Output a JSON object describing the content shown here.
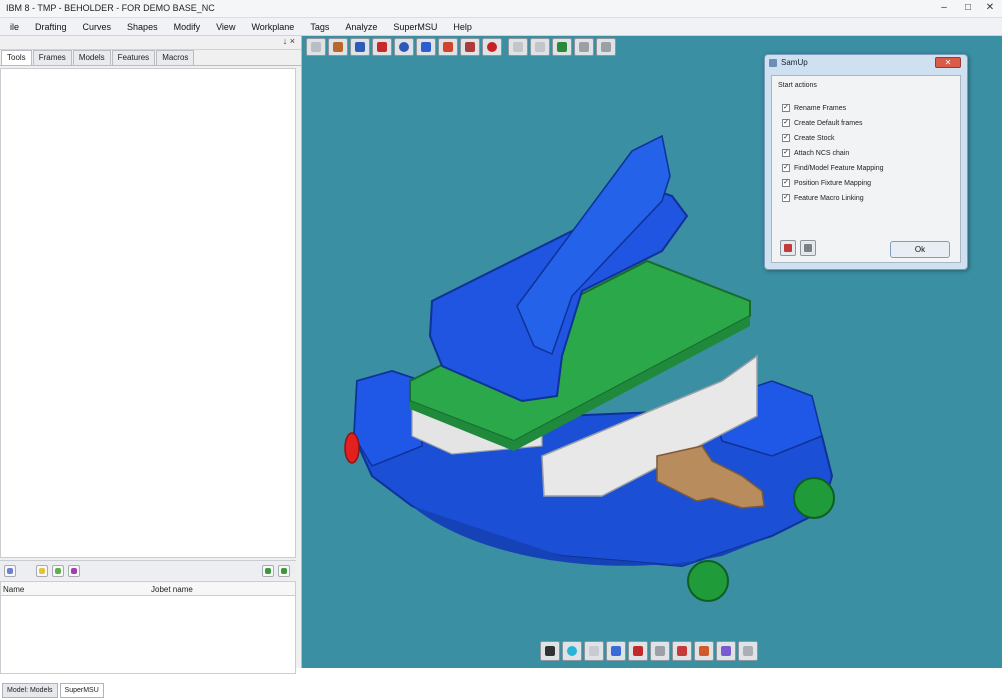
{
  "window": {
    "title": "IBM 8 - TMP - BEHOLDER - FOR DEMO BASE_NC",
    "controls": [
      "–",
      "□",
      "✕"
    ]
  },
  "menu": [
    "ile",
    "Drafting",
    "Curves",
    "Shapes",
    "Modify",
    "View",
    "Workplane",
    "Tags",
    "Analyze",
    "SuperMSU",
    "Help"
  ],
  "left_panel": {
    "pin": "↓ ×",
    "tabs": [
      "Tools",
      "Frames",
      "Models",
      "Features",
      "Macros"
    ],
    "active_tab": "Tools",
    "list_columns": [
      "Name",
      "Jobet name"
    ],
    "bottom_tabs": [
      "Model: Models",
      "SuperMSU"
    ]
  },
  "dialog": {
    "title": "SamUp",
    "close": "✕",
    "heading": "Start actions",
    "options": [
      {
        "label": "Rename Frames",
        "checked": true
      },
      {
        "label": "Create Default frames",
        "checked": true
      },
      {
        "label": "Create Stock",
        "checked": true
      },
      {
        "label": "Attach NCS chain",
        "checked": true
      },
      {
        "label": "Find/Model Feature Mapping",
        "checked": true
      },
      {
        "label": "Position Fixture Mapping",
        "checked": true
      },
      {
        "label": "Feature Macro Linking",
        "checked": true
      }
    ],
    "ok_label": "Ok"
  },
  "colors": {
    "viewport_bg": "#3a8fa3",
    "vise_body": "#1a4fd6",
    "vise_jaw": "#1f55e0",
    "plate": "#2aa84a",
    "rail": "#e8e8e8",
    "screw": "#b98c5e",
    "knob": "#1f9b3a",
    "red_knob": "#e22020"
  },
  "icons": {
    "viewport_toolbar": [
      "open-icon",
      "hand-icon",
      "frame-icon",
      "save-icon",
      "rotate-icon",
      "zoom-icon",
      "render-icon",
      "pan-icon",
      "arc-icon",
      "cut-icon",
      "measure-icon",
      "tree-icon",
      "split-icon",
      "move-icon"
    ],
    "bottom_toolbar": [
      "stop-icon",
      "refresh-icon",
      "draw-icon",
      "paint-icon",
      "close-tool-icon",
      "grid-icon",
      "select-icon",
      "pen-icon",
      "layer-icon",
      "ruler-icon",
      "fit-icon"
    ]
  }
}
